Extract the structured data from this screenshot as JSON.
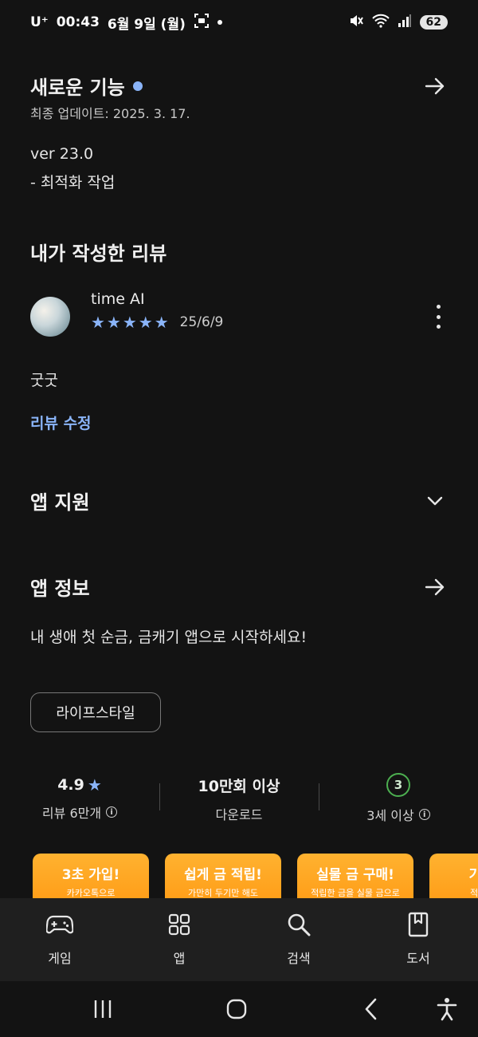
{
  "status_bar": {
    "carrier": "U⁺",
    "time": "00:43",
    "date": "6월 9일 (월)",
    "battery": "62"
  },
  "whats_new": {
    "title": "새로운 기능",
    "updated": "최종 업데이트: 2025. 3. 17.",
    "version": "ver 23.0",
    "note": "- 최적화 작업"
  },
  "my_review": {
    "section_title": "내가 작성한 리뷰",
    "reviewer": "time AI",
    "stars": "★★★★★",
    "rating": 5,
    "date": "25/6/9",
    "body": "굿굿",
    "edit_label": "리뷰 수정"
  },
  "app_support": {
    "title": "앱 지원"
  },
  "app_info": {
    "title": "앱 정보",
    "tagline": "내 생애 첫 순금, 금캐기 앱으로 시작하세요!",
    "category_chip": "라이프스타일"
  },
  "stats": {
    "rating_value": "4.9",
    "rating_label": "리뷰 6만개",
    "downloads_value": "10만회 이상",
    "downloads_label": "다운로드",
    "age_value": "3",
    "age_label": "3세 이상"
  },
  "banners": [
    {
      "title": "3초 가입!",
      "sub": "카카오톡으로"
    },
    {
      "title": "쉽게 금 적립!",
      "sub": "가만히 두기만 해도"
    },
    {
      "title": "실물 금 구매!",
      "sub": "적립한 금을 실물 금으로"
    },
    {
      "title": "기프티",
      "sub": "적립한 금"
    }
  ],
  "bottom_nav": {
    "games": "게임",
    "apps": "앱",
    "search": "검색",
    "books": "도서"
  },
  "colors": {
    "background": "#131313",
    "accent": "#8ab4f8",
    "banner": "#ffa21f",
    "age_green": "#4caf50"
  }
}
